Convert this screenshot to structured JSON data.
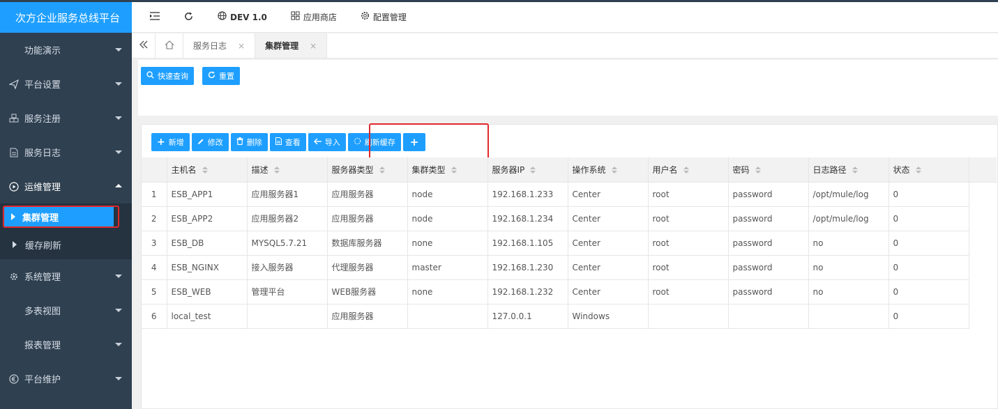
{
  "app": {
    "title": "次方企业服务总线平台"
  },
  "sidebar": {
    "items": [
      {
        "label": "功能演示"
      },
      {
        "label": "平台设置"
      },
      {
        "label": "服务注册"
      },
      {
        "label": "服务日志"
      },
      {
        "label": "运维管理"
      },
      {
        "label": "集群管理"
      },
      {
        "label": "缓存刷新"
      },
      {
        "label": "系统管理"
      },
      {
        "label": "多表视图"
      },
      {
        "label": "报表管理"
      },
      {
        "label": "平台维护"
      }
    ]
  },
  "topbar": {
    "env": "DEV 1.0",
    "app_store": "应用商店",
    "config": "配置管理"
  },
  "tabs": [
    {
      "label": "服务日志"
    },
    {
      "label": "集群管理"
    }
  ],
  "search": {
    "quick_query": "快速查询",
    "reset": "重置"
  },
  "toolbar": {
    "add": "新增",
    "edit": "修改",
    "delete": "删除",
    "view": "查看",
    "import": "导入",
    "refresh_cache": "刷新缓存",
    "plus": "+"
  },
  "table": {
    "columns": [
      "主机名",
      "描述",
      "服务器类型",
      "集群类型",
      "服务器IP",
      "操作系统",
      "用户名",
      "密码",
      "日志路径",
      "状态"
    ],
    "rows": [
      [
        "1",
        "ESB_APP1",
        "应用服务器1",
        "应用服务器",
        "node",
        "192.168.1.233",
        "Center",
        "root",
        "password",
        "/opt/mule/log",
        "0"
      ],
      [
        "2",
        "ESB_APP2",
        "应用服务器2",
        "应用服务器",
        "node",
        "192.168.1.234",
        "Center",
        "root",
        "password",
        "/opt/mule/log",
        "0"
      ],
      [
        "3",
        "ESB_DB",
        "MYSQL5.7.21",
        "数据库服务器",
        "none",
        "192.168.1.105",
        "Center",
        "root",
        "password",
        "no",
        "0"
      ],
      [
        "4",
        "ESB_NGINX",
        "接入服务器",
        "代理服务器",
        "master",
        "192.168.1.230",
        "Center",
        "root",
        "password",
        "no",
        "0"
      ],
      [
        "5",
        "ESB_WEB",
        "管理平台",
        "WEB服务器",
        "none",
        "192.168.1.232",
        "Center",
        "root",
        "password",
        "no",
        "0"
      ],
      [
        "6",
        "local_test",
        "",
        "应用服务器",
        "",
        "127.0.0.1",
        "Windows",
        "",
        "",
        "",
        "0"
      ]
    ]
  }
}
